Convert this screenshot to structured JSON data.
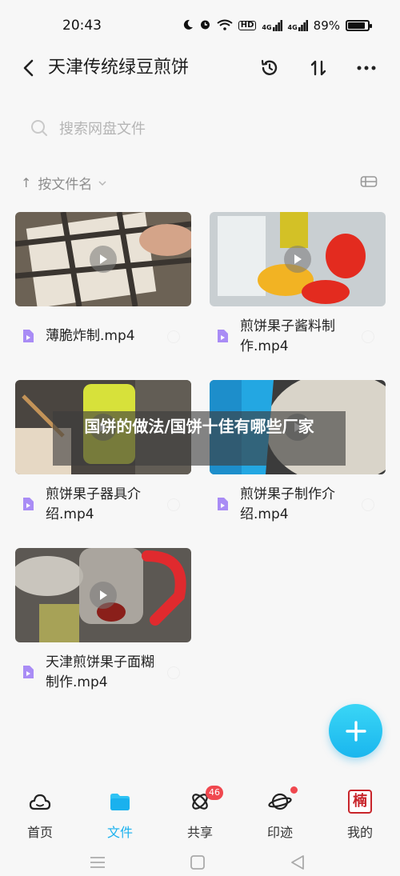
{
  "status_bar": {
    "time": "20:43",
    "network_a": "4G",
    "network_b": "4G",
    "battery_text": "89%",
    "battery_level": 0.89,
    "hd_label": "HD"
  },
  "header": {
    "title": "天津传统绿豆煎饼",
    "icons": [
      "back-arrow-icon",
      "history-icon",
      "sort-transfer-icon",
      "more-icon"
    ]
  },
  "search": {
    "placeholder": "搜索网盘文件"
  },
  "sort": {
    "label": "按文件名",
    "arrow": "↑"
  },
  "files": [
    {
      "name": "薄脆炸制.mp4",
      "thumb_colors": [
        "#6c6255",
        "#e9e2d6",
        "#3a3530"
      ]
    },
    {
      "name": "煎饼果子酱料制作.mp4",
      "thumb_colors": [
        "#c9cfd2",
        "#e32b1f",
        "#f2b323"
      ]
    },
    {
      "name": "煎饼果子器具介绍.mp4",
      "thumb_colors": [
        "#4a4540",
        "#d7e13a",
        "#e6d8c4"
      ]
    },
    {
      "name": "煎饼果子制作介绍.mp4",
      "thumb_colors": [
        "#3b3b3b",
        "#23a7e2",
        "#d9d4c9"
      ]
    },
    {
      "name": "天津煎饼果子面糊制作.mp4",
      "thumb_colors": [
        "#5c5853",
        "#e02a2e",
        "#c9c5bd"
      ]
    }
  ],
  "overlay_banner": "国饼的做法/国饼十佳有哪些厂家",
  "bottom_nav": [
    {
      "label": "首页",
      "icon": "home-cloud-icon",
      "active": false
    },
    {
      "label": "文件",
      "icon": "folder-icon",
      "active": true
    },
    {
      "label": "共享",
      "icon": "share-orbit-icon",
      "active": false,
      "badge": "46"
    },
    {
      "label": "印迹",
      "icon": "planet-icon",
      "active": false,
      "dot": true
    },
    {
      "label": "我的",
      "icon": "avatar-seal-icon",
      "active": false,
      "avatar_char": "楠"
    }
  ],
  "colors": {
    "accent": "#1ab1ee",
    "badge": "#f0484f",
    "background": "#f7f7f7"
  }
}
